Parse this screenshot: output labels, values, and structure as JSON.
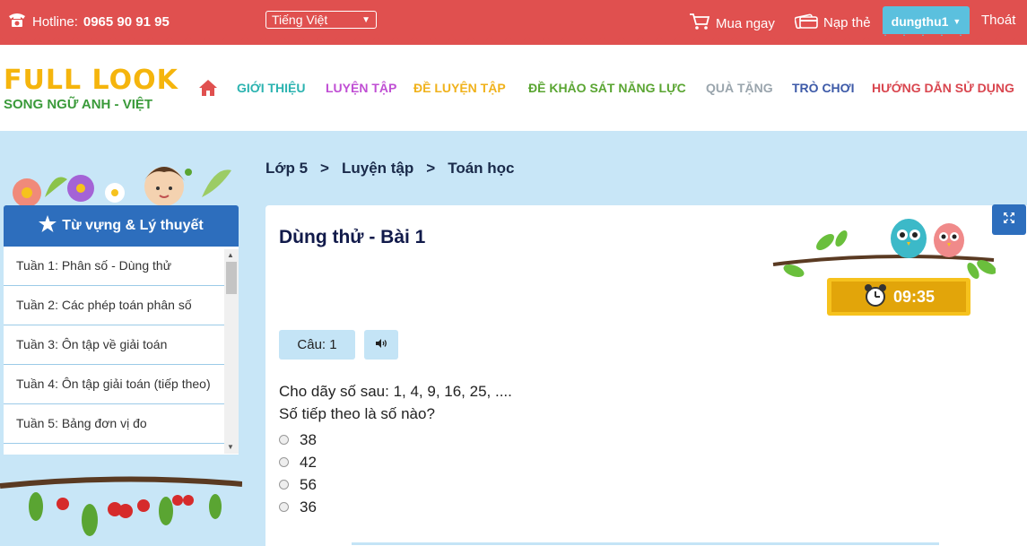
{
  "topbar": {
    "hotline_label": "Hotline:",
    "hotline_number": "0965 90 91 95",
    "language": "Tiếng Việt",
    "buy_label": "Mua ngay",
    "topup_label": "Nạp thẻ",
    "username": "dungthu1",
    "logout_label": "Thoát"
  },
  "logo": {
    "title": "FULL LOOK",
    "subtitle": "SONG NGỮ ANH - VIỆT"
  },
  "nav": {
    "items": [
      {
        "label": "GIỚI THIỆU",
        "color": "#2bb3b0"
      },
      {
        "label": "LUYỆN TẬP",
        "color": "#c04fd4"
      },
      {
        "label": "ĐỀ LUYỆN TẬP",
        "color": "#f0b21c"
      },
      {
        "label": "ĐỀ KHẢO SÁT NĂNG LỰC",
        "color": "#5aa532"
      },
      {
        "label": "QUÀ TẶNG",
        "color": "#9aa5ad"
      },
      {
        "label": "TRÒ CHƠI",
        "color": "#3d5aa8"
      },
      {
        "label": "HƯỚNG DẪN SỬ DỤNG",
        "color": "#d9464f"
      }
    ]
  },
  "breadcrumb": [
    "Lớp 5",
    ">",
    "Luyện tập",
    ">",
    "Toán học"
  ],
  "sidebar": {
    "title": "Từ vựng & Lý thuyết",
    "items": [
      "Tuần 1: Phân số - Dùng thử",
      "Tuần 2: Các phép toán phân số",
      "Tuần 3: Ôn tập về giải toán",
      "Tuần 4: Ôn tập giải toán (tiếp theo)",
      "Tuần 5: Bảng đơn vị đo"
    ]
  },
  "quiz": {
    "title": "Dùng thử - Bài 1",
    "timer": "09:35",
    "question_label": "Câu: 1",
    "question_line1": "Cho dãy số sau: 1, 4, 9, 16, 25, ....",
    "question_line2": "Số tiếp theo là số nào?",
    "options": [
      "38",
      "42",
      "56",
      "36"
    ]
  },
  "colors": {
    "topbar": "#e0504f",
    "accent_blue": "#2d6ebd",
    "timer": "#f6c21d",
    "background": "#c8e6f7"
  }
}
